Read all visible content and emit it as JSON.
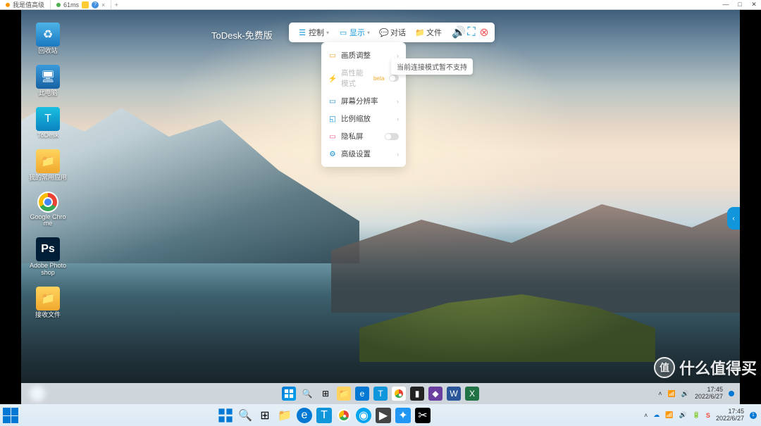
{
  "host": {
    "tabs": [
      {
        "label": "我是值高级",
        "indicator": "#ff9800"
      },
      {
        "label": "61ms",
        "indicator": "#4caf50"
      }
    ],
    "window_controls": {
      "min": "—",
      "max": "□",
      "close": "✕"
    }
  },
  "todesk": {
    "title": "ToDesk-免费版",
    "toolbar": {
      "control": "控制",
      "display": "显示",
      "dialog": "对话",
      "file": "文件"
    },
    "menu": {
      "quality": "画质调整",
      "highperf": "高性能模式",
      "beta": "beta",
      "resolution": "屏幕分辨率",
      "scale": "比例缩放",
      "privacy": "隐私屏",
      "advanced": "高级设置"
    },
    "tooltip": "当前连接模式暂不支持"
  },
  "desktop_icons": {
    "recycle": "回收站",
    "thispc": "此电脑",
    "todesk": "ToDesk",
    "folder1": "我的常用应用",
    "chrome": "Google Chrome",
    "ps": "Adobe Photoshop",
    "folder2": "接收文件"
  },
  "remote_taskbar": {
    "time": "17:45",
    "date": "2022/6/27"
  },
  "outer_taskbar": {
    "time": "17:45",
    "date": "2022/6/27"
  },
  "watermark": "什么值得买"
}
